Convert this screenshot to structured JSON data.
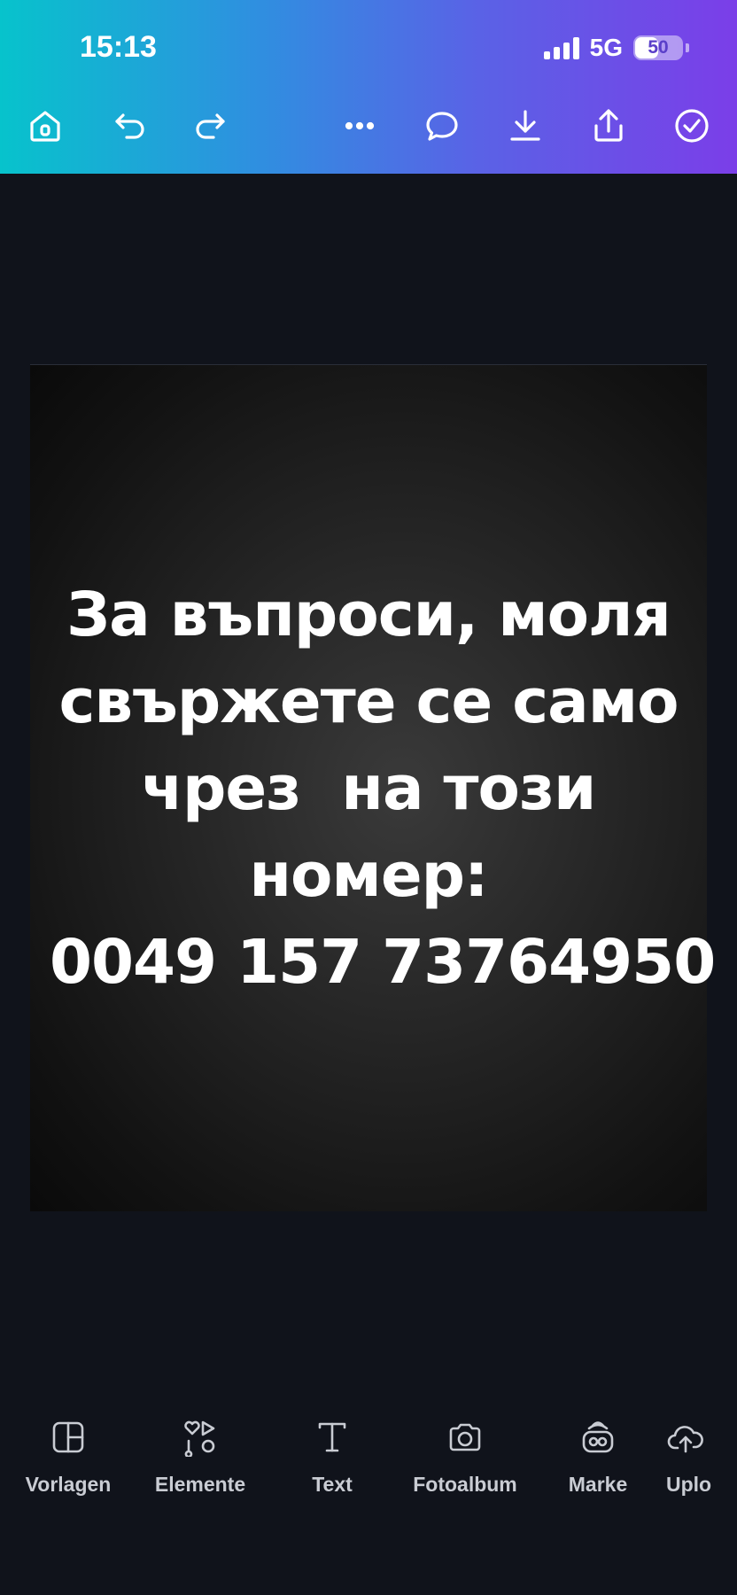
{
  "status_bar": {
    "time": "15:13",
    "network": "5G",
    "battery_level": "50",
    "battery_fraction": 0.5
  },
  "toolbar": {
    "items": [
      {
        "name": "home-button",
        "icon": "home-icon"
      },
      {
        "name": "undo-button",
        "icon": "undo-icon"
      },
      {
        "name": "redo-button",
        "icon": "redo-icon"
      },
      {
        "name": "more-button",
        "icon": "more-icon"
      },
      {
        "name": "comment-button",
        "icon": "comment-icon"
      },
      {
        "name": "download-button",
        "icon": "download-icon"
      },
      {
        "name": "share-button",
        "icon": "share-icon"
      },
      {
        "name": "done-button",
        "icon": "check-circle-icon"
      }
    ]
  },
  "design": {
    "lines": [
      "За въпроси, моля",
      "свържете се само",
      "чрез  на този",
      "номер:",
      "0049 157 73764950"
    ]
  },
  "bottom_nav": {
    "items": [
      {
        "label": "Vorlagen",
        "icon": "templates-icon"
      },
      {
        "label": "Elemente",
        "icon": "elements-icon"
      },
      {
        "label": "Text",
        "icon": "text-icon"
      },
      {
        "label": "Fotoalbum",
        "icon": "camera-icon"
      },
      {
        "label": "Marke",
        "icon": "brand-icon"
      },
      {
        "label": "Uplo",
        "icon": "upload-icon"
      }
    ]
  },
  "colors": {
    "background": "#10131b",
    "gradient_start": "#07c3cc",
    "gradient_end": "#7b3ee8",
    "nav_text": "#c9ccd3"
  }
}
